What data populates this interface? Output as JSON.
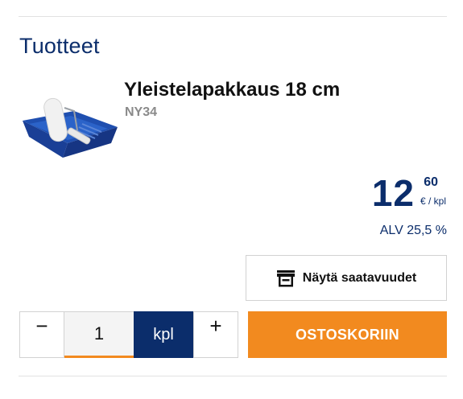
{
  "section": {
    "title": "Tuotteet"
  },
  "product": {
    "name": "Yleistelapakkaus 18 cm",
    "code": "NY34",
    "image_icon": "paint-roller-tray-icon"
  },
  "price": {
    "integer": "12",
    "decimals": "60",
    "unit": "€ / kpl",
    "vat": "ALV 25,5 %"
  },
  "availability": {
    "label": "Näytä saatavuudet",
    "icon": "store-icon"
  },
  "quantity": {
    "minus": "−",
    "value": "1",
    "unit": "kpl",
    "plus": "+"
  },
  "cart": {
    "label": "OSTOSKORIIN"
  },
  "colors": {
    "brand_blue": "#0b2d6b",
    "accent_orange": "#f28a1f"
  }
}
